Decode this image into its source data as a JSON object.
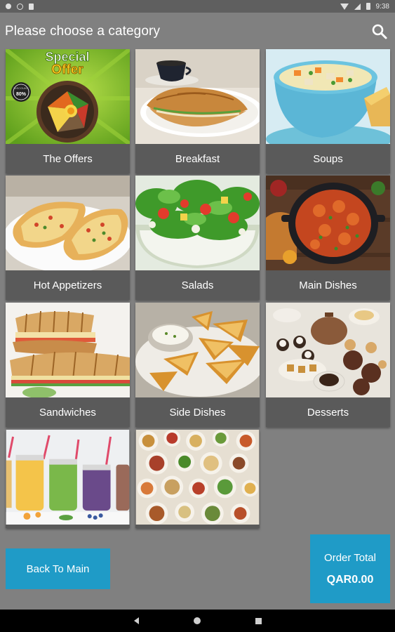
{
  "status_bar": {
    "time": "9:38",
    "icons": [
      "gear-icon",
      "circle-icon",
      "sd-card-icon",
      "wifi-icon",
      "signal-icon",
      "battery-icon"
    ]
  },
  "header": {
    "title": "Please choose a category",
    "search_icon": "search-icon"
  },
  "categories": [
    {
      "label": "The Offers",
      "image": "special-offer-bibimbap-image",
      "badge_line1": "Special",
      "badge_line2": "Offer",
      "discount": "80%"
    },
    {
      "label": "Breakfast",
      "image": "croissant-coffee-image"
    },
    {
      "label": "Soups",
      "image": "soup-bowl-image"
    },
    {
      "label": "Hot Appetizers",
      "image": "stuffed-bread-image"
    },
    {
      "label": "Salads",
      "image": "salad-bowl-image"
    },
    {
      "label": "Main Dishes",
      "image": "curry-pot-image"
    },
    {
      "label": "Sandwiches",
      "image": "panini-image"
    },
    {
      "label": "Side Dishes",
      "image": "potato-wedges-image"
    },
    {
      "label": "Desserts",
      "image": "dessert-table-image"
    },
    {
      "label": "",
      "image": "smoothie-jars-image"
    },
    {
      "label": "",
      "image": "buffet-spread-image"
    }
  ],
  "footer": {
    "back_label": "Back To Main",
    "order_total_label": "Order Total",
    "order_total_value": "QAR0.00"
  },
  "colors": {
    "background": "#808080",
    "tile_label_bg": "#5a5a5a",
    "accent": "#1f9bc7"
  },
  "nav_bar": {
    "icons": [
      "back-icon",
      "home-icon",
      "recents-icon"
    ]
  }
}
